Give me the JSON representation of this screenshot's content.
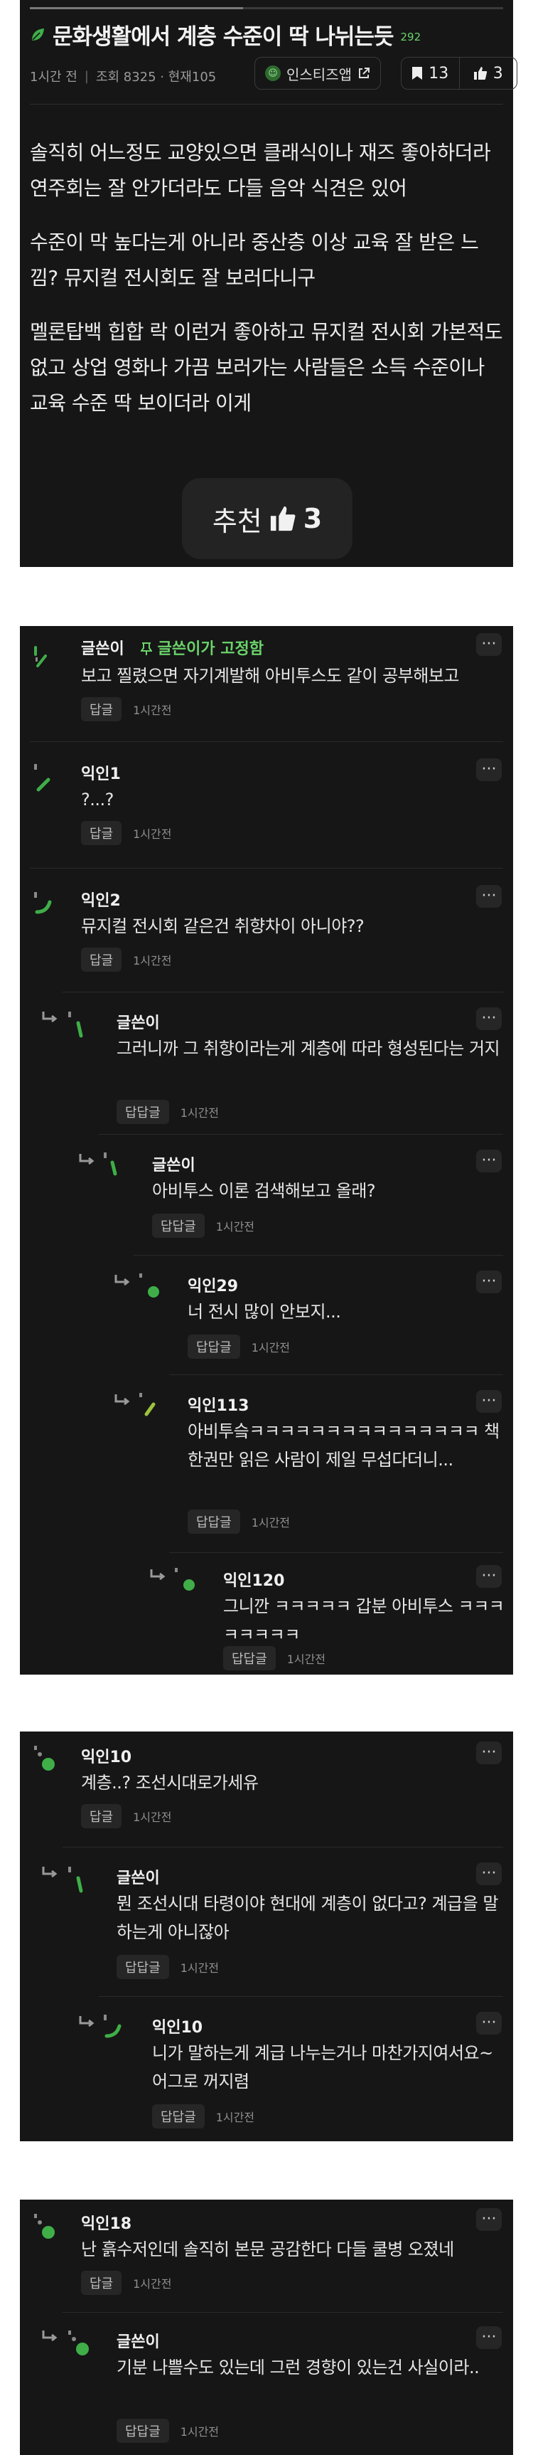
{
  "post": {
    "progress": 0.45,
    "title": "문화생활에서 계층 수준이 딱 나뉘는듯",
    "title_count": "292",
    "time": "1시간 전",
    "views": "조회 8325 · 현재105",
    "source_label": "인스티즈앱",
    "bookmark_count": "13",
    "like_count": "3",
    "paragraphs": [
      "솔직히 어느정도 교양있으면 클래식이나 재즈 좋아하더라 연주회는 잘 안가더라도 다들 음악 식견은 있어",
      "수준이 막 높다는게 아니라 중산층 이상 교육 잘 받은 느낌? 뮤지컬 전시회도 잘 보러다니구",
      "멜론탑백 힙합 락 이런거 좋아하고 뮤지컬 전시회 가본적도 없고 상업 영화나 가끔 보러가는 사람들은 소득 수준이나 교육 수준 딱 보이더라 이게"
    ],
    "recommend_label": "추천",
    "recommend_count": "3"
  },
  "labels": {
    "reply": "답글",
    "reply_reply": "답답글",
    "more": "···"
  },
  "comments": [
    {
      "author": "글쓴이",
      "pin": "글쓴이가 고정함",
      "text": "보고 찔렸으면 자기계발해 아비투스도 같이 공부해보고",
      "time": "1시간전"
    },
    {
      "author": "익인1",
      "text": "?...?",
      "time": "1시간전"
    },
    {
      "author": "익인2",
      "text": "뮤지컬 전시회 같은건 취향차이 아니야??",
      "time": "1시간전"
    },
    {
      "author": "글쓴이",
      "text": "그러니까 그 취향이라는게 계층에 따라 형성된다는 거지",
      "time": "1시간전"
    },
    {
      "author": "글쓴이",
      "text": "아비투스 이론 검색해보고 올래?",
      "time": "1시간전"
    },
    {
      "author": "익인29",
      "text": "너 전시 많이 안보지...",
      "time": "1시간전"
    },
    {
      "author": "익인113",
      "text": "아비투슼ㅋㅋㅋㅋㅋㅋㅋㅋㅋㅋㅋㅋㅋㅋㅋ 책 한권만 읽은 사람이 제일 무섭다더니...",
      "time": "1시간전"
    },
    {
      "author": "익인120",
      "text": "그니깐 ㅋㅋㅋㅋㅋ 갑분 아비투스 ㅋㅋㅋㅋㅋㅋㅋㅋ",
      "time": "1시간전"
    },
    {
      "author": "익인10",
      "text": "계층..? 조선시대로가세유",
      "time": "1시간전"
    },
    {
      "author": "글쓴이",
      "text": "뭔 조선시대 타령이야 현대에 계층이 없다고? 계급을 말하는게 아니잖아",
      "time": "1시간전"
    },
    {
      "author": "익인10",
      "text": "니가 말하는게 계급 나누는거나 마찬가지여서요~ 어그로 꺼지렴",
      "time": "1시간전"
    },
    {
      "author": "익인18",
      "text": "난 흙수저인데 솔직히 본문 공감한다 다들 쿨병 오졌네",
      "time": "1시간전"
    },
    {
      "author": "글쓴이",
      "text": "기분 나쁠수도 있는데 그런 경향이 있는건 사실이라..",
      "time": "1시간전"
    }
  ]
}
